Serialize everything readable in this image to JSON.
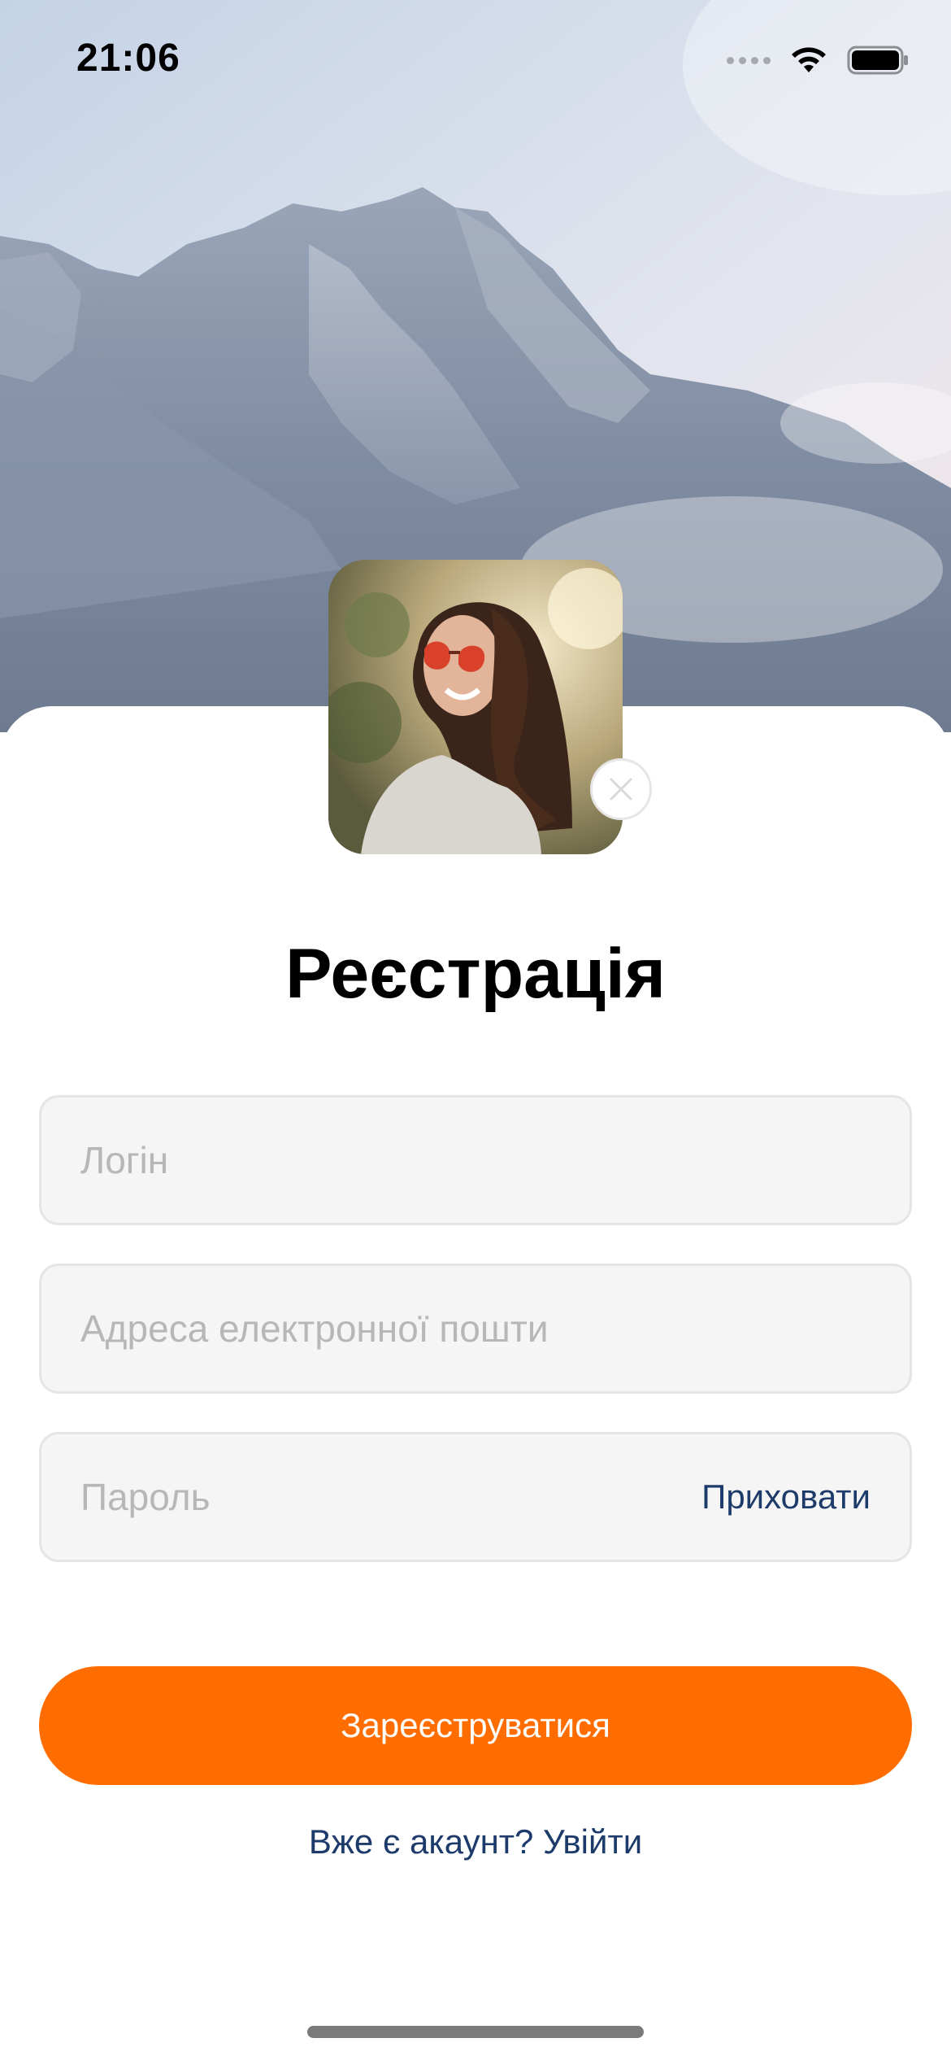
{
  "status_bar": {
    "time": "21:06",
    "icons": [
      "cellular-signal-icon",
      "wifi-icon",
      "battery-icon"
    ]
  },
  "background": {
    "image": "mountain-photo"
  },
  "avatar": {
    "image": "profile-photo",
    "remove_icon": "close-icon"
  },
  "title": "Реєстрація",
  "form": {
    "login": {
      "placeholder": "Логін",
      "value": ""
    },
    "email": {
      "placeholder": "Адреса електронної пошти",
      "value": ""
    },
    "password": {
      "placeholder": "Пароль",
      "value": "",
      "toggle_label": "Приховати"
    }
  },
  "register_button": "Зареєструватися",
  "login_link": "Вже є акаунт? Увійти",
  "colors": {
    "accent": "#ff6d00",
    "link": "#1d3b6a",
    "field_bg": "#f5f5f5",
    "placeholder": "#b7b7b7"
  }
}
